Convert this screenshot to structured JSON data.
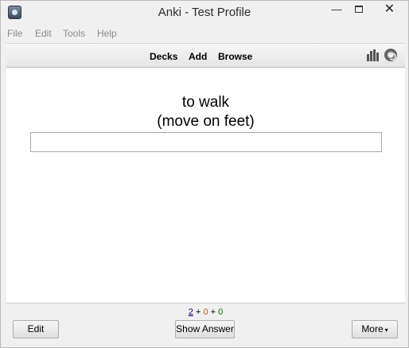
{
  "window": {
    "title": "Anki - Test Profile",
    "min_glyph": "—",
    "close_glyph": "✕"
  },
  "menubar": {
    "items": [
      "File",
      "Edit",
      "Tools",
      "Help"
    ]
  },
  "toolbar": {
    "decks_label": "Decks",
    "add_label": "Add",
    "browse_label": "Browse",
    "stats_icon": "bar-chart-icon",
    "sync_icon": "sync-icon"
  },
  "card": {
    "front_line1": "to walk",
    "front_line2": "(move on feet)",
    "answer_value": ""
  },
  "bottombar": {
    "new_count": "2",
    "learn_count": "0",
    "review_count": "0",
    "plus": "+",
    "edit_label": "Edit",
    "show_answer_label": "Show Answer",
    "more_label": "More",
    "more_caret": "▾"
  },
  "colors": {
    "new": "#000080",
    "learning": "#c35617",
    "review": "#007700"
  }
}
